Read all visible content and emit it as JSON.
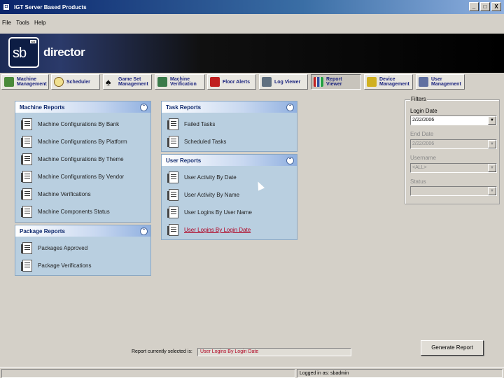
{
  "window": {
    "title": "IGT Server Based Products",
    "min": "_",
    "max": "□",
    "close": "X"
  },
  "menu": [
    "File",
    "Tools",
    "Help"
  ],
  "banner": {
    "logo_text": "sb",
    "logo_badge": "IGT",
    "product": "director"
  },
  "toolbar": [
    {
      "label1": "Machine",
      "label2": "Management",
      "icon_color": "#4a8a3a"
    },
    {
      "label1": "Scheduler",
      "label2": "",
      "icon_color": "#e0c060"
    },
    {
      "label1": "Game Set",
      "label2": "Management",
      "icon_color": "#101010"
    },
    {
      "label1": "Machine",
      "label2": "Verification",
      "icon_color": "#3a7a4a"
    },
    {
      "label1": "Floor Alerts",
      "label2": "",
      "icon_color": "#c02020"
    },
    {
      "label1": "Log Viewer",
      "label2": "",
      "icon_color": "#607080"
    },
    {
      "label1": "Report",
      "label2": "Viewer",
      "icon_color": "#3050a0"
    },
    {
      "label1": "Device",
      "label2": "Management",
      "icon_color": "#d0b020"
    },
    {
      "label1": "User",
      "label2": "Management",
      "icon_color": "#6070a0"
    }
  ],
  "panels": {
    "machine": {
      "title": "Machine Reports",
      "items": [
        "Machine Configurations By Bank",
        "Machine Configurations By Platform",
        "Machine Configurations By Theme",
        "Machine Configurations By Vendor",
        "Machine Verifications",
        "Machine Components Status"
      ]
    },
    "package": {
      "title": "Package Reports",
      "items": [
        "Packages Approved",
        "Package Verifications"
      ]
    },
    "task": {
      "title": "Task Reports",
      "items": [
        "Failed Tasks",
        "Scheduled Tasks"
      ]
    },
    "user": {
      "title": "User Reports",
      "items": [
        "User Activity By Date",
        "User Activity By Name",
        "User Logins By User Name",
        "User Logins By Login Date"
      ]
    },
    "collapse_glyph": "⌃"
  },
  "filters": {
    "title": "Filters",
    "login_date_label": "Login Date",
    "login_date_value": "2/22/2006",
    "end_date_label": "End Date",
    "end_date_value": "2/22/2006",
    "username_label": "Username",
    "username_value": "<ALL>",
    "status_label": "Status",
    "status_value": "",
    "dropdown_glyph": "▼"
  },
  "bottom": {
    "selected_label": "Report currently selected is:",
    "selected_value": "User Logins By Login Date",
    "generate_label": "Generate Report"
  },
  "status": {
    "logged_in": "Logged in as: sbadmin"
  }
}
